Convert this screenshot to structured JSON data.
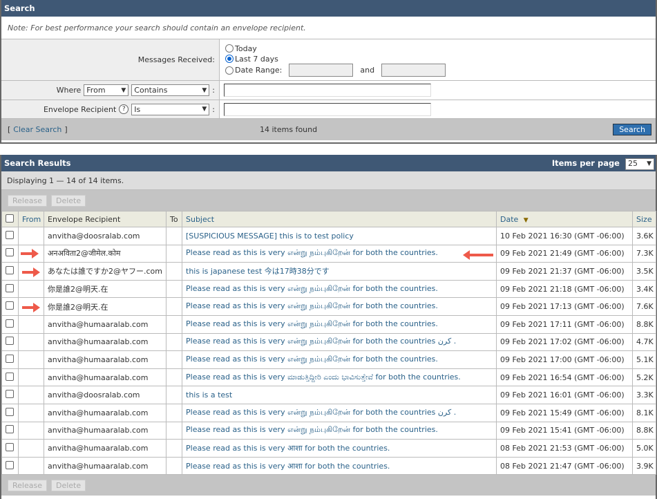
{
  "search": {
    "title": "Search",
    "note": "Note: For best performance your search should contain an envelope recipient.",
    "messages_received_label": "Messages Received:",
    "options": [
      "Today",
      "Last 7 days",
      "Date Range:"
    ],
    "selected_option": "Last 7 days",
    "and_label": "and",
    "where_label": "Where",
    "where_field": "From",
    "where_operator": "Contains",
    "envelope_label": "Envelope Recipient",
    "envelope_operator": "Is",
    "colon": ":",
    "help_icon": "?",
    "clear_search": "Clear Search",
    "bracket_open": "[",
    "bracket_close": "]",
    "found": "14 items found",
    "search_button": "Search"
  },
  "results": {
    "title": "Search Results",
    "items_per_page_label": "Items per page",
    "items_per_page": "25",
    "displaying": "Displaying 1 — 14 of 14 items.",
    "release": "Release",
    "delete": "Delete",
    "columns": [
      "From",
      "Envelope Recipient",
      "To",
      "Subject",
      "Date",
      "Size"
    ],
    "sort_icon": "sort-descending-triangle",
    "rows": [
      {
        "from": "",
        "recipient": "anvitha@doosralab.com",
        "to": "",
        "subject": "[SUSPICIOUS MESSAGE] this is to test policy",
        "date": "10 Feb 2021 16:30 (GMT -06:00)",
        "size": "3.6K"
      },
      {
        "from": "",
        "recipient": "अनअविता2@जीमेल.कोम",
        "to": "",
        "subject": "Please read as this is very என்று நம்புகிறேன் for both the countries.",
        "date": "09 Feb 2021 21:49 (GMT -06:00)",
        "size": "7.3K"
      },
      {
        "from": "",
        "recipient": "あなたは誰ですか2@ヤフー.com",
        "to": "",
        "subject": "this is japanese test 今は17時38分です",
        "date": "09 Feb 2021 21:37 (GMT -06:00)",
        "size": "3.5K"
      },
      {
        "from": "",
        "recipient": "你是誰2@明天.在",
        "to": "",
        "subject": "Please read as this is very என்று நம்புகிறேன் for both the countries.",
        "date": "09 Feb 2021 21:18 (GMT -06:00)",
        "size": "3.4K"
      },
      {
        "from": "",
        "recipient": "你是誰2@明天.在",
        "to": "",
        "subject": "Please read as this is very என்று நம்புகிறேன் for both the countries.",
        "date": "09 Feb 2021 17:13 (GMT -06:00)",
        "size": "7.6K"
      },
      {
        "from": "",
        "recipient": "anvitha@humaaralab.com",
        "to": "",
        "subject": "Please read as this is very என்று நம்புகிறேன் for both the countries.",
        "date": "09 Feb 2021 17:11 (GMT -06:00)",
        "size": "8.8K"
      },
      {
        "from": "",
        "recipient": "anvitha@humaaralab.com",
        "to": "",
        "subject": "Please read as this is very என்று நம்புகிறேன் for both the countries کرن .",
        "date": "09 Feb 2021 17:02 (GMT -06:00)",
        "size": "4.7K"
      },
      {
        "from": "",
        "recipient": "anvitha@humaaralab.com",
        "to": "",
        "subject": "Please read as this is very என்று நம்புகிறேன் for both the countries.",
        "date": "09 Feb 2021 17:00 (GMT -06:00)",
        "size": "5.1K"
      },
      {
        "from": "",
        "recipient": "anvitha@humaaralab.com",
        "to": "",
        "subject": "Please read as this is very ಮಾಡುತ್ತಿದ್ದೀರಿ ಎಂದು ಭಾವಿಸುತ್ತೇವೆ for both the countries.",
        "date": "09 Feb 2021 16:54 (GMT -06:00)",
        "size": "5.2K"
      },
      {
        "from": "",
        "recipient": "anvitha@doosralab.com",
        "to": "",
        "subject": "this is a test",
        "date": "09 Feb 2021 16:01 (GMT -06:00)",
        "size": "3.3K"
      },
      {
        "from": "",
        "recipient": "anvitha@humaaralab.com",
        "to": "",
        "subject": "Please read as this is very என்று நம்புகிறேன் for both the countries کرن .",
        "date": "09 Feb 2021 15:49 (GMT -06:00)",
        "size": "8.1K"
      },
      {
        "from": "",
        "recipient": "anvitha@humaaralab.com",
        "to": "",
        "subject": "Please read as this is very என்று நம்புகிறேன் for both the countries.",
        "date": "09 Feb 2021 15:41 (GMT -06:00)",
        "size": "8.8K"
      },
      {
        "from": "",
        "recipient": "anvitha@humaaralab.com",
        "to": "",
        "subject": "Please read as this is very आशा for both the countries.",
        "date": "08 Feb 2021 21:53 (GMT -06:00)",
        "size": "5.0K"
      },
      {
        "from": "",
        "recipient": "anvitha@humaaralab.com",
        "to": "",
        "subject": "Please read as this is very आशा for both the countries.",
        "date": "08 Feb 2021 21:47 (GMT -06:00)",
        "size": "3.9K"
      }
    ]
  },
  "colors": {
    "header": "#3f5875",
    "link": "#2a6189",
    "annotation_arrow": "#ee5a4a",
    "search_button": "#2e6fae"
  }
}
